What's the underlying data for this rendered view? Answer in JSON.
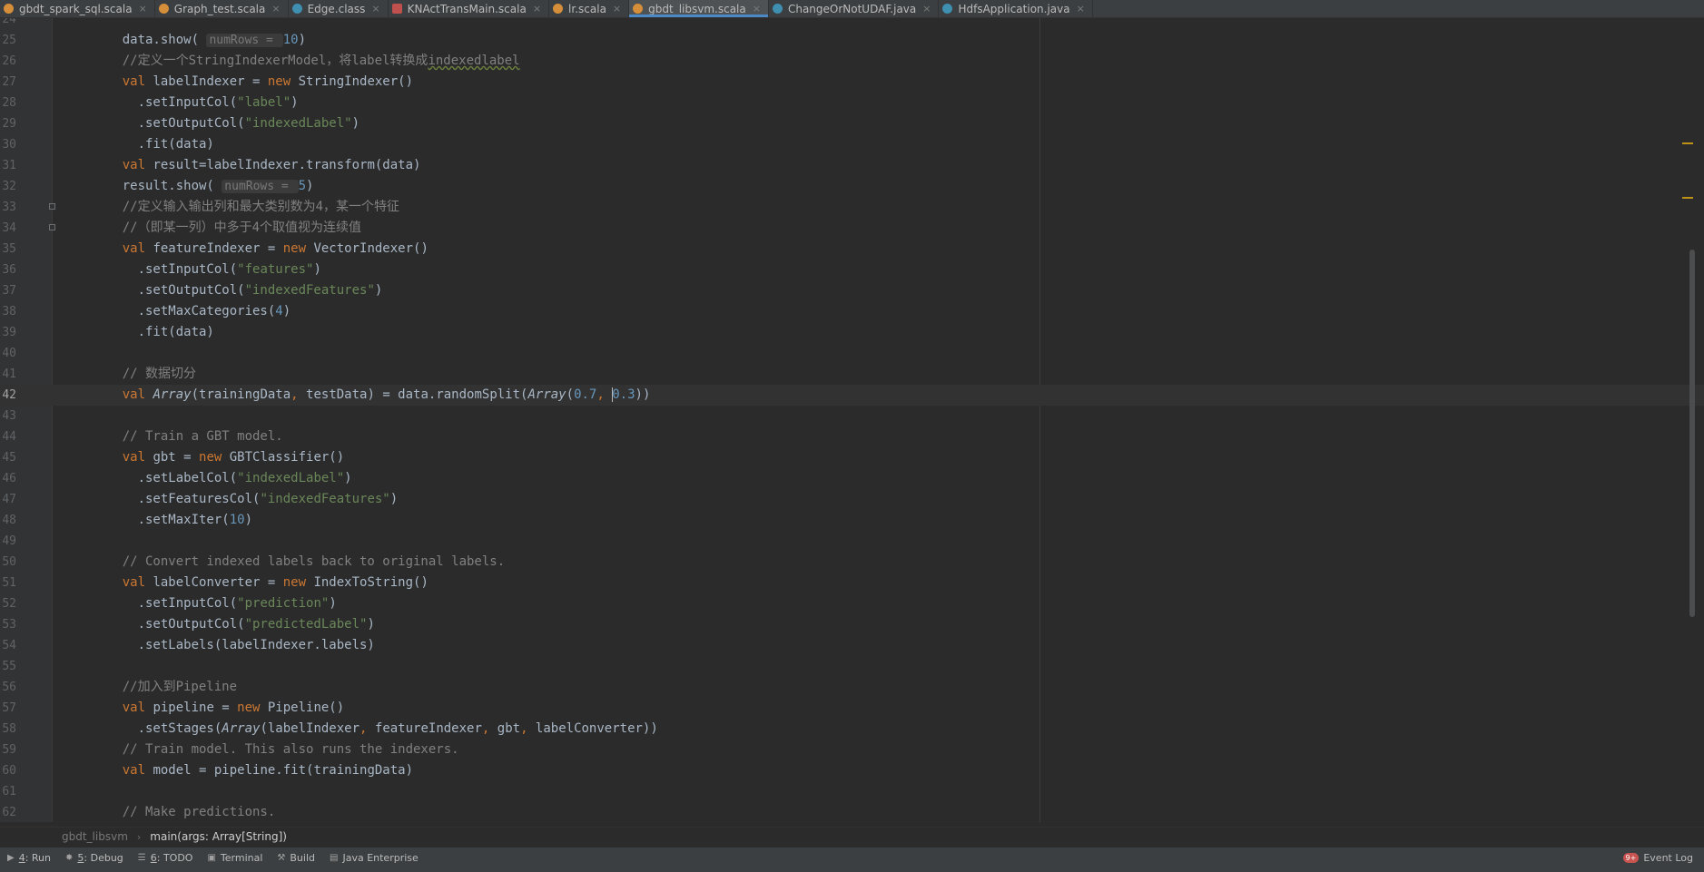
{
  "tabs": [
    {
      "icon": "scala-file-icon",
      "kind": "scala",
      "label": "gbdt_spark_sql.scala",
      "active": false
    },
    {
      "icon": "scala-file-icon",
      "kind": "scala",
      "label": "Graph_test.scala",
      "active": false
    },
    {
      "icon": "class-file-icon",
      "kind": "cls",
      "label": "Edge.class",
      "active": false
    },
    {
      "icon": "scala-object-icon",
      "kind": "obj",
      "label": "KNActTransMain.scala",
      "active": false
    },
    {
      "icon": "scala-file-icon",
      "kind": "scala",
      "label": "lr.scala",
      "active": false
    },
    {
      "icon": "scala-file-icon",
      "kind": "scala",
      "label": "gbdt_libsvm.scala",
      "active": true
    },
    {
      "icon": "java-class-icon",
      "kind": "java",
      "label": "ChangeOrNotUDAF.java",
      "active": false
    },
    {
      "icon": "java-class-icon",
      "kind": "java",
      "label": "HdfsApplication.java",
      "active": false
    }
  ],
  "editor": {
    "current_line": "42",
    "lines": [
      {
        "num": "24",
        "code": []
      },
      {
        "num": "25",
        "code": [
          [
            "t",
            "    data.show( "
          ],
          [
            "h",
            "numRows = "
          ],
          [
            "n",
            "10"
          ],
          [
            "t",
            ")"
          ]
        ]
      },
      {
        "num": "26",
        "code": [
          [
            "c",
            "    //定义一个StringIndexerModel，将label转换成"
          ],
          [
            "cu",
            "indexedlabel"
          ]
        ]
      },
      {
        "num": "27",
        "code": [
          [
            "k",
            "    val "
          ],
          [
            "t",
            "labelIndexer = "
          ],
          [
            "k",
            "new "
          ],
          [
            "t",
            "StringIndexer()"
          ]
        ]
      },
      {
        "num": "28",
        "code": [
          [
            "t",
            "      .setInputCol("
          ],
          [
            "s",
            "\"label\""
          ],
          [
            "t",
            ")"
          ]
        ]
      },
      {
        "num": "29",
        "code": [
          [
            "t",
            "      .setOutputCol("
          ],
          [
            "s",
            "\"indexedLabel\""
          ],
          [
            "t",
            ")"
          ]
        ]
      },
      {
        "num": "30",
        "code": [
          [
            "t",
            "      .fit(data)"
          ]
        ]
      },
      {
        "num": "31",
        "code": [
          [
            "k",
            "    val "
          ],
          [
            "t",
            "result=labelIndexer.transform(data)"
          ]
        ]
      },
      {
        "num": "32",
        "code": [
          [
            "t",
            "    result.show( "
          ],
          [
            "h",
            "numRows = "
          ],
          [
            "n",
            "5"
          ],
          [
            "t",
            ")"
          ]
        ]
      },
      {
        "num": "33",
        "code": [
          [
            "c",
            "    //定义输入输出列和最大类别数为4，某一个特征"
          ]
        ]
      },
      {
        "num": "34",
        "code": [
          [
            "c",
            "    //（即某一列）中多于4个取值视为连续值"
          ]
        ]
      },
      {
        "num": "35",
        "code": [
          [
            "k",
            "    val "
          ],
          [
            "t",
            "featureIndexer = "
          ],
          [
            "k",
            "new "
          ],
          [
            "t",
            "VectorIndexer()"
          ]
        ]
      },
      {
        "num": "36",
        "code": [
          [
            "t",
            "      .setInputCol("
          ],
          [
            "s",
            "\"features\""
          ],
          [
            "t",
            ")"
          ]
        ]
      },
      {
        "num": "37",
        "code": [
          [
            "t",
            "      .setOutputCol("
          ],
          [
            "s",
            "\"indexedFeatures\""
          ],
          [
            "t",
            ")"
          ]
        ]
      },
      {
        "num": "38",
        "code": [
          [
            "t",
            "      .setMaxCategories("
          ],
          [
            "n",
            "4"
          ],
          [
            "t",
            ")"
          ]
        ]
      },
      {
        "num": "39",
        "code": [
          [
            "t",
            "      .fit(data)"
          ]
        ]
      },
      {
        "num": "40",
        "code": []
      },
      {
        "num": "41",
        "code": [
          [
            "c",
            "    // 数据切分"
          ]
        ]
      },
      {
        "num": "42",
        "code": [
          [
            "k",
            "    val "
          ],
          [
            "ti",
            "Array"
          ],
          [
            "t",
            "(trainingData"
          ],
          [
            "k",
            ", "
          ],
          [
            "t",
            "testData) = data.randomSplit("
          ],
          [
            "ti",
            "Array"
          ],
          [
            "t",
            "("
          ],
          [
            "n",
            "0.7"
          ],
          [
            "k",
            ", "
          ],
          [
            "cur",
            ""
          ],
          [
            "n",
            "0.3"
          ],
          [
            "t",
            "))"
          ]
        ]
      },
      {
        "num": "43",
        "code": []
      },
      {
        "num": "44",
        "code": [
          [
            "c",
            "    // Train a GBT model."
          ]
        ]
      },
      {
        "num": "45",
        "code": [
          [
            "k",
            "    val "
          ],
          [
            "t",
            "gbt = "
          ],
          [
            "k",
            "new "
          ],
          [
            "t",
            "GBTClassifier()"
          ]
        ]
      },
      {
        "num": "46",
        "code": [
          [
            "t",
            "      .setLabelCol("
          ],
          [
            "s",
            "\"indexedLabel\""
          ],
          [
            "t",
            ")"
          ]
        ]
      },
      {
        "num": "47",
        "code": [
          [
            "t",
            "      .setFeaturesCol("
          ],
          [
            "s",
            "\"indexedFeatures\""
          ],
          [
            "t",
            ")"
          ]
        ]
      },
      {
        "num": "48",
        "code": [
          [
            "t",
            "      .setMaxIter("
          ],
          [
            "n",
            "10"
          ],
          [
            "t",
            ")"
          ]
        ]
      },
      {
        "num": "49",
        "code": []
      },
      {
        "num": "50",
        "code": [
          [
            "c",
            "    // Convert indexed labels back to original labels."
          ]
        ]
      },
      {
        "num": "51",
        "code": [
          [
            "k",
            "    val "
          ],
          [
            "t",
            "labelConverter = "
          ],
          [
            "k",
            "new "
          ],
          [
            "t",
            "IndexToString()"
          ]
        ]
      },
      {
        "num": "52",
        "code": [
          [
            "t",
            "      .setInputCol("
          ],
          [
            "s",
            "\"prediction\""
          ],
          [
            "t",
            ")"
          ]
        ]
      },
      {
        "num": "53",
        "code": [
          [
            "t",
            "      .setOutputCol("
          ],
          [
            "s",
            "\"predictedLabel\""
          ],
          [
            "t",
            ")"
          ]
        ]
      },
      {
        "num": "54",
        "code": [
          [
            "t",
            "      .setLabels(labelIndexer.labels)"
          ]
        ]
      },
      {
        "num": "55",
        "code": []
      },
      {
        "num": "56",
        "code": [
          [
            "c",
            "    //加入到Pipeline"
          ]
        ]
      },
      {
        "num": "57",
        "code": [
          [
            "k",
            "    val "
          ],
          [
            "t",
            "pipeline = "
          ],
          [
            "k",
            "new "
          ],
          [
            "t",
            "Pipeline()"
          ]
        ]
      },
      {
        "num": "58",
        "code": [
          [
            "t",
            "      .setStages("
          ],
          [
            "ti",
            "Array"
          ],
          [
            "t",
            "(labelIndexer"
          ],
          [
            "k",
            ", "
          ],
          [
            "t",
            "featureIndexer"
          ],
          [
            "k",
            ", "
          ],
          [
            "t",
            "gbt"
          ],
          [
            "k",
            ", "
          ],
          [
            "t",
            "labelConverter))"
          ]
        ]
      },
      {
        "num": "59",
        "code": [
          [
            "c",
            "    // Train model. This also runs the indexers."
          ]
        ]
      },
      {
        "num": "60",
        "code": [
          [
            "k",
            "    val "
          ],
          [
            "t",
            "model = pipeline.fit(trainingData)"
          ]
        ]
      },
      {
        "num": "61",
        "code": []
      },
      {
        "num": "62",
        "code": [
          [
            "c",
            "    // Make predictions."
          ]
        ]
      }
    ],
    "fold_lines": [
      "33",
      "34"
    ]
  },
  "breadcrumb": {
    "file": "gbdt_libsvm",
    "method": "main(args: Array[String])"
  },
  "toolbar": {
    "run": {
      "mnemonic": "4",
      "label": ": Run"
    },
    "debug": {
      "mnemonic": "5",
      "label": ": Debug"
    },
    "todo": {
      "mnemonic": "6",
      "label": ": TODO"
    },
    "terminal": {
      "label": "Terminal"
    },
    "build": {
      "label": "Build"
    },
    "java_enterprise": {
      "label": "Java Enterprise"
    },
    "event_log": {
      "label": "Event Log",
      "badge": "9+"
    }
  },
  "colors": {
    "keyword": "#cc7832",
    "string": "#6a8759",
    "number": "#6897bb",
    "comment": "#808080",
    "active_tab_underline": "#4a88c7"
  }
}
